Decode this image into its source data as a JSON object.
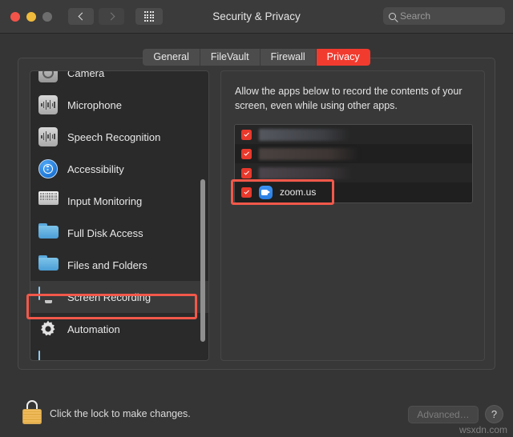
{
  "window": {
    "title": "Security & Privacy",
    "traffic_lights": [
      "close",
      "minimize",
      "zoom"
    ]
  },
  "toolbar": {
    "back_icon": "chevron-left-icon",
    "forward_icon": "chevron-right-icon",
    "grid_icon": "show-all-grid-icon",
    "search_placeholder": "Search",
    "search_value": "",
    "search_icon": "search-icon"
  },
  "tabs": [
    {
      "label": "General",
      "active": false
    },
    {
      "label": "FileVault",
      "active": false
    },
    {
      "label": "Firewall",
      "active": false
    },
    {
      "label": "Privacy",
      "active": true
    }
  ],
  "sidebar": {
    "items": [
      {
        "label": "Camera",
        "icon": "camera-icon",
        "selected": false,
        "partial": "top"
      },
      {
        "label": "Microphone",
        "icon": "microphone-icon",
        "selected": false
      },
      {
        "label": "Speech Recognition",
        "icon": "speech-recognition-icon",
        "selected": false
      },
      {
        "label": "Accessibility",
        "icon": "accessibility-icon",
        "selected": false
      },
      {
        "label": "Input Monitoring",
        "icon": "keyboard-icon",
        "selected": false
      },
      {
        "label": "Full Disk Access",
        "icon": "folder-icon",
        "selected": false
      },
      {
        "label": "Files and Folders",
        "icon": "folder-icon",
        "selected": false
      },
      {
        "label": "Screen Recording",
        "icon": "screen-icon",
        "selected": true
      },
      {
        "label": "Automation",
        "icon": "gear-icon",
        "selected": false
      }
    ],
    "highlight": "Screen Recording"
  },
  "main": {
    "description": "Allow the apps below to record the contents of your screen, even while using other apps.",
    "apps": [
      {
        "name": "",
        "redacted": true,
        "checked": true,
        "icon": ""
      },
      {
        "name": "",
        "redacted": true,
        "checked": true,
        "icon": ""
      },
      {
        "name": "",
        "redacted": true,
        "checked": true,
        "icon": ""
      },
      {
        "name": "zoom.us",
        "redacted": false,
        "checked": true,
        "icon": "zoom-app-icon"
      }
    ],
    "highlight": "zoom.us"
  },
  "footer": {
    "lock_icon": "padlock-locked-icon",
    "lock_text": "Click the lock to make changes.",
    "advanced_label": "Advanced…",
    "help_label": "?"
  },
  "watermark": "wsxdn.com",
  "colors": {
    "accent_red": "#f23b2f",
    "highlight_red": "#f2584a",
    "checkbox_red": "#e8392c",
    "window_bg": "#353535",
    "panel_bg": "#383838",
    "list_bg": "#1f1f1f"
  }
}
